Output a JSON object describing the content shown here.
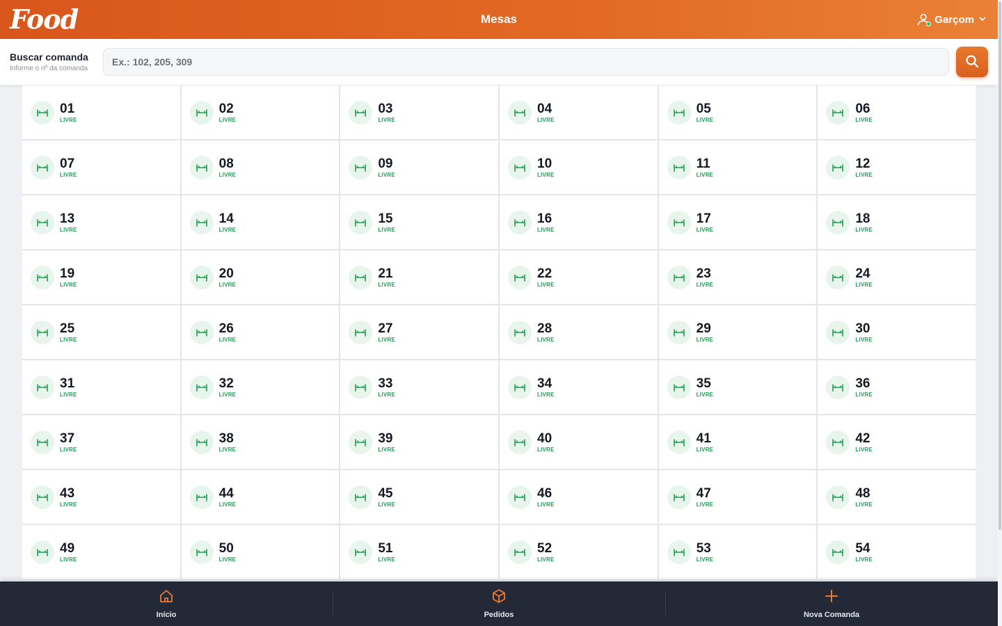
{
  "header": {
    "logo": "Food",
    "title": "Mesas",
    "user_label": "Garçom"
  },
  "search": {
    "label": "Buscar comanda",
    "sublabel": "Informe o nº da comanda",
    "placeholder": "Ex.: 102, 205, 309"
  },
  "tables": [
    {
      "number": "01",
      "status": "LIVRE"
    },
    {
      "number": "02",
      "status": "LIVRE"
    },
    {
      "number": "03",
      "status": "LIVRE"
    },
    {
      "number": "04",
      "status": "LIVRE"
    },
    {
      "number": "05",
      "status": "LIVRE"
    },
    {
      "number": "06",
      "status": "LIVRE"
    },
    {
      "number": "07",
      "status": "LIVRE"
    },
    {
      "number": "08",
      "status": "LIVRE"
    },
    {
      "number": "09",
      "status": "LIVRE"
    },
    {
      "number": "10",
      "status": "LIVRE"
    },
    {
      "number": "11",
      "status": "LIVRE"
    },
    {
      "number": "12",
      "status": "LIVRE"
    },
    {
      "number": "13",
      "status": "LIVRE"
    },
    {
      "number": "14",
      "status": "LIVRE"
    },
    {
      "number": "15",
      "status": "LIVRE"
    },
    {
      "number": "16",
      "status": "LIVRE"
    },
    {
      "number": "17",
      "status": "LIVRE"
    },
    {
      "number": "18",
      "status": "LIVRE"
    },
    {
      "number": "19",
      "status": "LIVRE"
    },
    {
      "number": "20",
      "status": "LIVRE"
    },
    {
      "number": "21",
      "status": "LIVRE"
    },
    {
      "number": "22",
      "status": "LIVRE"
    },
    {
      "number": "23",
      "status": "LIVRE"
    },
    {
      "number": "24",
      "status": "LIVRE"
    },
    {
      "number": "25",
      "status": "LIVRE"
    },
    {
      "number": "26",
      "status": "LIVRE"
    },
    {
      "number": "27",
      "status": "LIVRE"
    },
    {
      "number": "28",
      "status": "LIVRE"
    },
    {
      "number": "29",
      "status": "LIVRE"
    },
    {
      "number": "30",
      "status": "LIVRE"
    },
    {
      "number": "31",
      "status": "LIVRE"
    },
    {
      "number": "32",
      "status": "LIVRE"
    },
    {
      "number": "33",
      "status": "LIVRE"
    },
    {
      "number": "34",
      "status": "LIVRE"
    },
    {
      "number": "35",
      "status": "LIVRE"
    },
    {
      "number": "36",
      "status": "LIVRE"
    },
    {
      "number": "37",
      "status": "LIVRE"
    },
    {
      "number": "38",
      "status": "LIVRE"
    },
    {
      "number": "39",
      "status": "LIVRE"
    },
    {
      "number": "40",
      "status": "LIVRE"
    },
    {
      "number": "41",
      "status": "LIVRE"
    },
    {
      "number": "42",
      "status": "LIVRE"
    },
    {
      "number": "43",
      "status": "LIVRE"
    },
    {
      "number": "44",
      "status": "LIVRE"
    },
    {
      "number": "45",
      "status": "LIVRE"
    },
    {
      "number": "46",
      "status": "LIVRE"
    },
    {
      "number": "47",
      "status": "LIVRE"
    },
    {
      "number": "48",
      "status": "LIVRE"
    },
    {
      "number": "49",
      "status": "LIVRE"
    },
    {
      "number": "50",
      "status": "LIVRE"
    },
    {
      "number": "51",
      "status": "LIVRE"
    },
    {
      "number": "52",
      "status": "LIVRE"
    },
    {
      "number": "53",
      "status": "LIVRE"
    },
    {
      "number": "54",
      "status": "LIVRE"
    }
  ],
  "table_icon": "table-icon",
  "bottom_nav": [
    {
      "label": "Início",
      "icon": "home-icon"
    },
    {
      "label": "Pedidos",
      "icon": "box-icon"
    },
    {
      "label": "Nova Comanda",
      "icon": "plus-icon"
    }
  ],
  "colors": {
    "brand_orange": "#e26a24",
    "status_free_green": "#1f9d55",
    "nav_background": "#242938"
  }
}
